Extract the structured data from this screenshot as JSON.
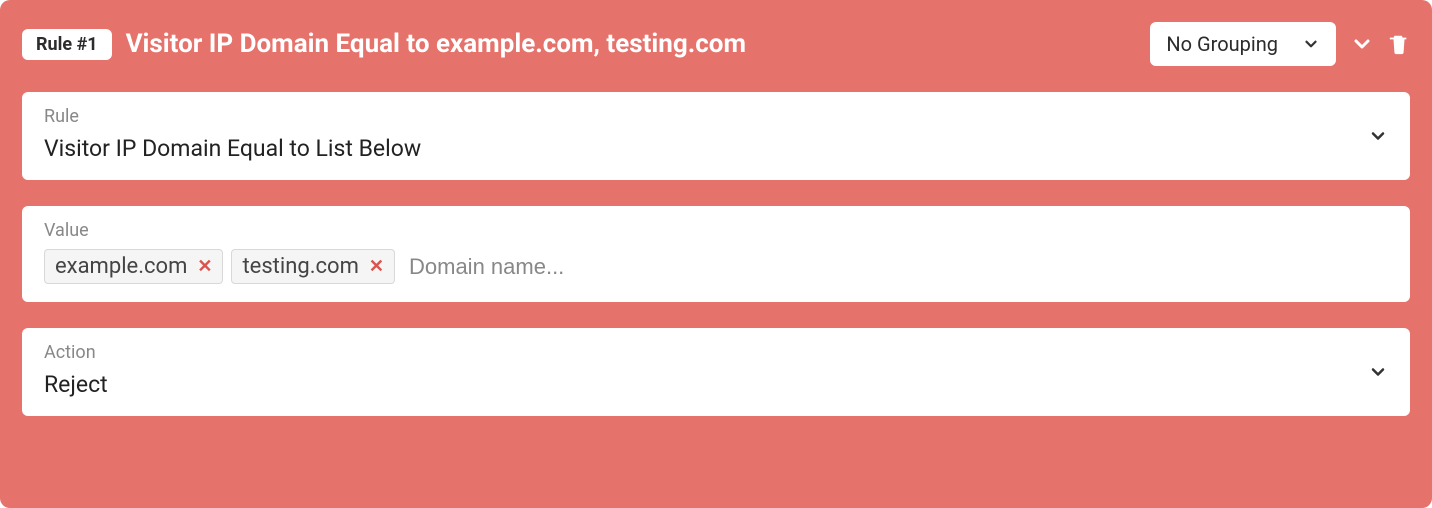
{
  "header": {
    "badge": "Rule #1",
    "title": "Visitor IP Domain Equal to example.com, testing.com",
    "grouping_selected": "No Grouping"
  },
  "rule_panel": {
    "label": "Rule",
    "value": "Visitor IP Domain Equal to List Below"
  },
  "value_panel": {
    "label": "Value",
    "tags": [
      "example.com",
      "testing.com"
    ],
    "placeholder": "Domain name..."
  },
  "action_panel": {
    "label": "Action",
    "value": "Reject"
  }
}
